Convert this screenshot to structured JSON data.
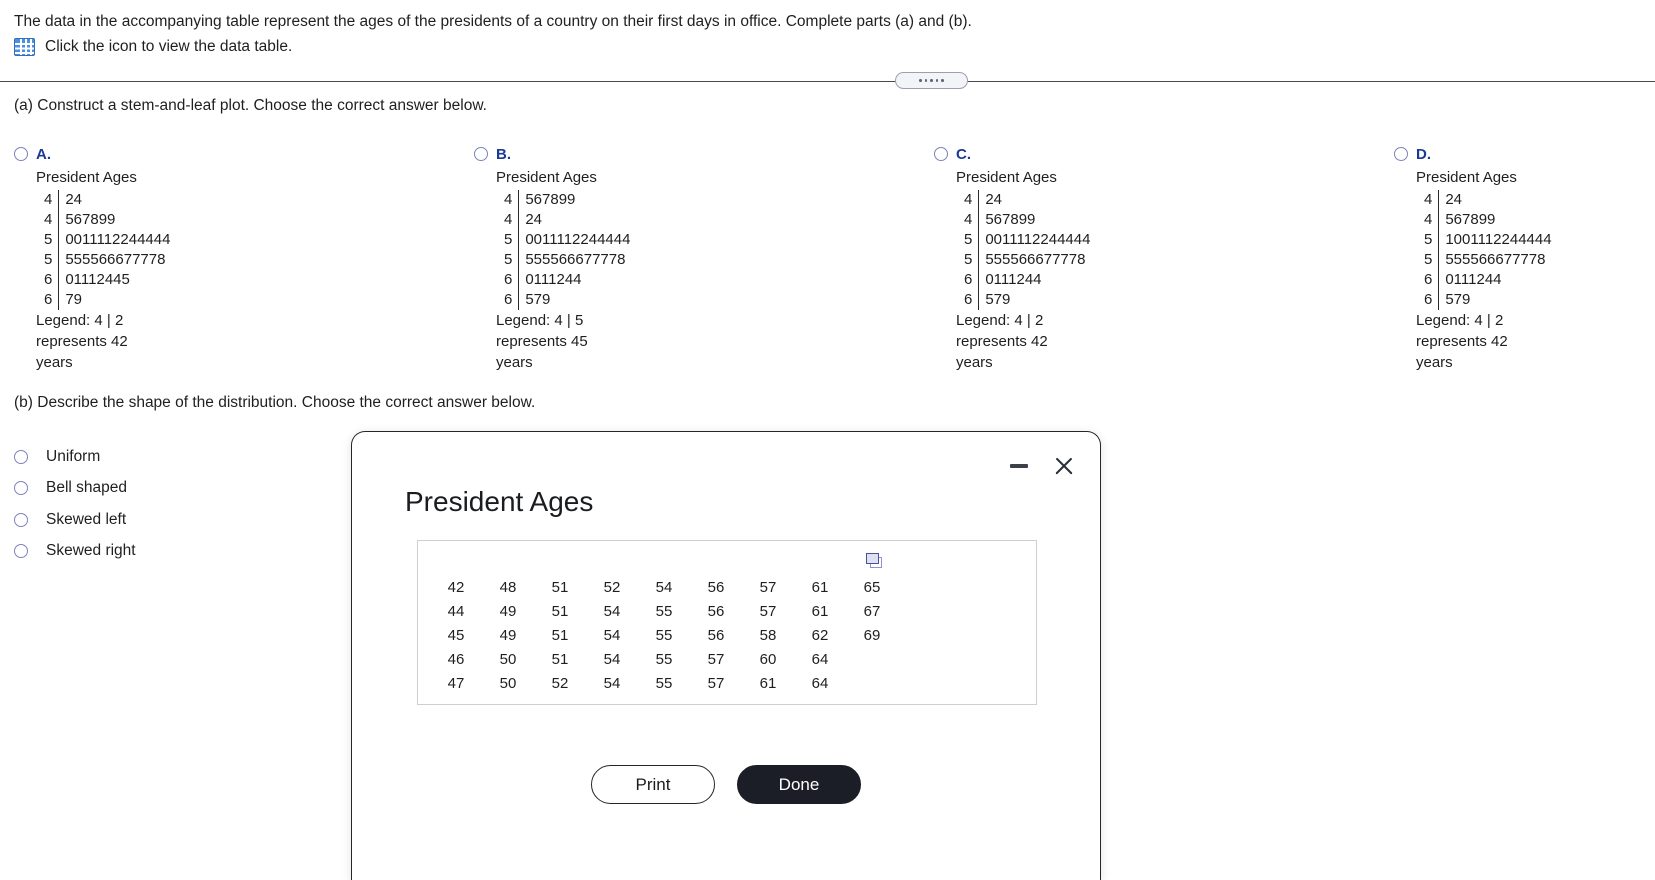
{
  "header": {
    "prompt": "The data in the accompanying table represent the ages of the presidents of a country on their first days in office. Complete parts (a) and (b).",
    "icon_link_text": "Click the icon to view the data table.",
    "table_icon": "table-grid-icon"
  },
  "part_a": {
    "label": "(a) Construct a stem-and-leaf plot. Choose the correct answer below.",
    "choices": [
      {
        "letter": "A.",
        "title": "President Ages",
        "rows": [
          {
            "stem": "4",
            "leaves": "24"
          },
          {
            "stem": "4",
            "leaves": "567899"
          },
          {
            "stem": "5",
            "leaves": "0011112244444"
          },
          {
            "stem": "5",
            "leaves": "555566677778"
          },
          {
            "stem": "6",
            "leaves": "01112445"
          },
          {
            "stem": "6",
            "leaves": "79"
          }
        ],
        "legend_line1": "Legend: 4 | 2",
        "legend_line2": "represents 42",
        "legend_line3": "years"
      },
      {
        "letter": "B.",
        "title": "President Ages",
        "rows": [
          {
            "stem": "4",
            "leaves": "567899"
          },
          {
            "stem": "4",
            "leaves": "24"
          },
          {
            "stem": "5",
            "leaves": "0011112244444"
          },
          {
            "stem": "5",
            "leaves": "555566677778"
          },
          {
            "stem": "6",
            "leaves": "0111244"
          },
          {
            "stem": "6",
            "leaves": "579"
          }
        ],
        "legend_line1": "Legend: 4 | 5",
        "legend_line2": "represents 45",
        "legend_line3": "years"
      },
      {
        "letter": "C.",
        "title": "President Ages",
        "rows": [
          {
            "stem": "4",
            "leaves": "24"
          },
          {
            "stem": "4",
            "leaves": "567899"
          },
          {
            "stem": "5",
            "leaves": "0011112244444"
          },
          {
            "stem": "5",
            "leaves": "555566677778"
          },
          {
            "stem": "6",
            "leaves": "0111244"
          },
          {
            "stem": "6",
            "leaves": "579"
          }
        ],
        "legend_line1": "Legend: 4 | 2",
        "legend_line2": "represents 42",
        "legend_line3": "years"
      },
      {
        "letter": "D.",
        "title": "President Ages",
        "rows": [
          {
            "stem": "4",
            "leaves": "24"
          },
          {
            "stem": "4",
            "leaves": "567899"
          },
          {
            "stem": "5",
            "leaves": "1001112244444"
          },
          {
            "stem": "5",
            "leaves": "555566677778"
          },
          {
            "stem": "6",
            "leaves": "0111244"
          },
          {
            "stem": "6",
            "leaves": "579"
          }
        ],
        "legend_line1": "Legend: 4 | 2",
        "legend_line2": "represents 42",
        "legend_line3": "years"
      }
    ]
  },
  "part_b": {
    "label": "(b) Describe the shape of the distribution. Choose the correct answer below.",
    "options": [
      {
        "label": "Uniform"
      },
      {
        "label": "Bell shaped"
      },
      {
        "label": "Skewed left"
      },
      {
        "label": "Skewed right"
      }
    ]
  },
  "modal": {
    "title": "President Ages",
    "minimize_icon": "minimize-icon",
    "close_icon": "close-icon",
    "copy_icon": "copy-icon",
    "table_rows": [
      [
        "42",
        "48",
        "51",
        "52",
        "54",
        "56",
        "57",
        "61",
        "65"
      ],
      [
        "44",
        "49",
        "51",
        "54",
        "55",
        "56",
        "57",
        "61",
        "67"
      ],
      [
        "45",
        "49",
        "51",
        "54",
        "55",
        "56",
        "58",
        "62",
        "69"
      ],
      [
        "46",
        "50",
        "51",
        "54",
        "55",
        "57",
        "60",
        "64",
        ""
      ],
      [
        "47",
        "50",
        "52",
        "54",
        "55",
        "57",
        "61",
        "64",
        ""
      ]
    ],
    "print_label": "Print",
    "done_label": "Done"
  },
  "colors": {
    "choice_letter": "#1b3a93",
    "radio_outline": "#7c84b8",
    "table_icon": "#4a8fe0",
    "done_button_bg": "#1b1e27",
    "copy_icon": "#4a4f9e"
  }
}
